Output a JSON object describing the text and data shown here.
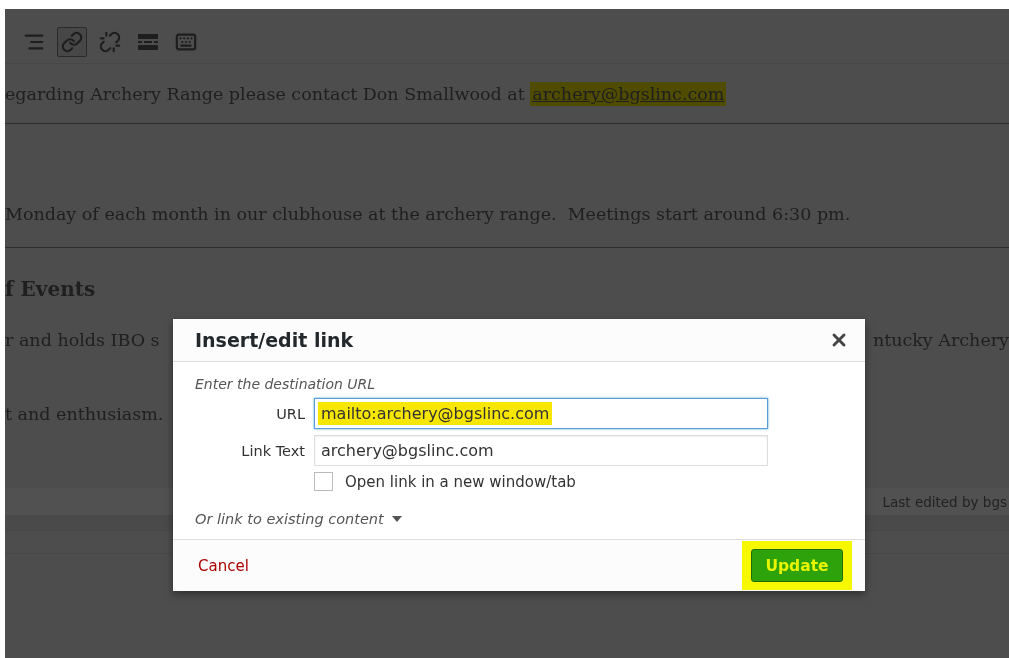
{
  "editor": {
    "toolbar": [
      {
        "kind": "align-right",
        "active": false
      },
      {
        "kind": "link",
        "active": true
      },
      {
        "kind": "unlink",
        "active": false
      },
      {
        "kind": "more",
        "active": false
      },
      {
        "kind": "toolbar-toggle",
        "active": false
      }
    ],
    "content": [
      {
        "kind": "paragraph",
        "text": "egarding Archery Range please contact Don Smallwood at",
        "link": {
          "text": "archery@bgslinc.com",
          "highlighted": true
        }
      },
      {
        "kind": "paragraph",
        "text": "Monday of each month in our clubhouse at the archery range.  Meetings start around 6:30 pm."
      },
      {
        "kind": "heading",
        "text": "f Events"
      },
      {
        "kind": "paragraph",
        "text": "r and holds IBO s",
        "text_right": "ntucky Archery"
      },
      {
        "kind": "paragraph",
        "text": "t and enthusiasm."
      }
    ],
    "status_bar": {
      "text": "Last edited by bgs"
    }
  },
  "dialog": {
    "title": "Insert/edit link",
    "hint": "Enter the destination URL",
    "fields": [
      {
        "label": "URL",
        "value": "mailto:archery@bgslinc.com",
        "focused": true,
        "highlighted": true
      },
      {
        "label": "Link Text",
        "value": "archery@bgslinc.com",
        "focused": false,
        "highlighted": false
      }
    ],
    "new_tab": {
      "label": "Open link in a new window/tab",
      "checked": false
    },
    "existing_content": {
      "label": "Or link to existing content",
      "expanded": false
    },
    "cancel": "Cancel",
    "submit": {
      "label": "Update",
      "highlighted": true
    }
  }
}
